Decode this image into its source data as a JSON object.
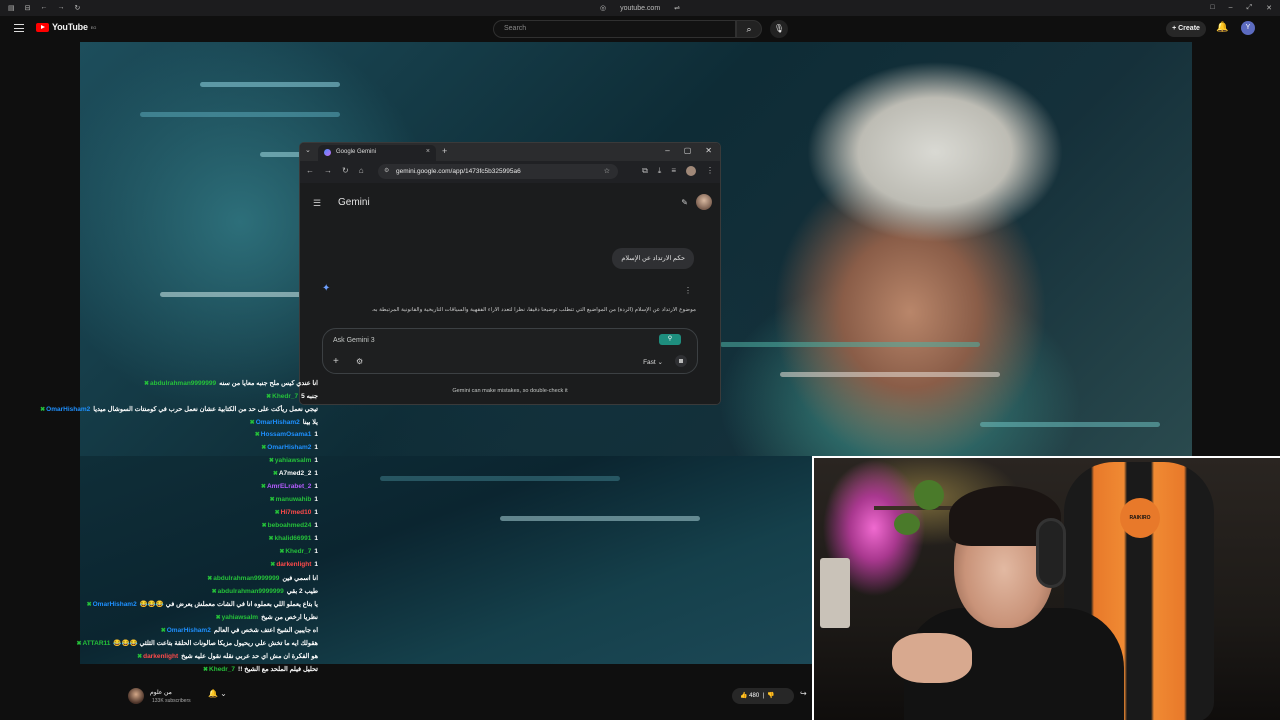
{
  "browser": {
    "url": "youtube.com"
  },
  "youtube": {
    "logo": "YouTube",
    "logo_region": "EG",
    "search_placeholder": "Search",
    "create_label": "Create",
    "avatar_letter": "Y"
  },
  "gemini_window": {
    "tab_title": "Google Gemini",
    "url": "gemini.google.com/app/1473fc5b325995a6",
    "brand": "Gemini",
    "user_prompt": "حكم الارتداد عن الإسلام",
    "response_preview": "موضوع الارتداد عن الإسلام (الردة) من المواضيع التي تتطلب توضيحاً دقيقاً، نظراً لتعدد الآراء الفقهية والسياقات التاريخية والقانونية المرتبطة به.",
    "input_placeholder": "Ask Gemini 3",
    "mode_label": "Fast",
    "disclaimer": "Gemini can make mistakes, so double-check it"
  },
  "chat": {
    "lines": [
      {
        "user": "abdulrahman9999999",
        "msg": "انا عندي كيس ملح جنبه معايا من سنه",
        "color": "#25c03a"
      },
      {
        "user": "Khedr_7",
        "msg": "جنبه 5",
        "color": "#25c03a"
      },
      {
        "user": "OmarHisham2",
        "msg": "تيجي نعمل ريأكت على حد من الكتابية عشان نعمل حرب في كومنتات السوشال ميديا",
        "color": "#1e90ff"
      },
      {
        "user": "OmarHisham2",
        "msg": "يلا بينا",
        "color": "#1e90ff"
      },
      {
        "user": "HossamOsama1",
        "msg": "1",
        "color": "#1e90ff"
      },
      {
        "user": "OmarHisham2",
        "msg": "1",
        "color": "#1e90ff"
      },
      {
        "user": "yahiawsalm",
        "msg": "1",
        "color": "#25c03a"
      },
      {
        "user": "A7med2_2",
        "msg": "1",
        "color": "#ffffff"
      },
      {
        "user": "AmrELrabet_2",
        "msg": "1",
        "color": "#b55bff"
      },
      {
        "user": "manuwahib",
        "msg": "1",
        "color": "#25c03a"
      },
      {
        "user": "Hi7med10",
        "msg": "1",
        "color": "#ff4a4a"
      },
      {
        "user": "beboahmed24",
        "msg": "1",
        "color": "#25c03a"
      },
      {
        "user": "khalid66991",
        "msg": "1",
        "color": "#25c03a"
      },
      {
        "user": "Khedr_7",
        "msg": "1",
        "color": "#25c03a"
      },
      {
        "user": "darkenlight",
        "msg": "1",
        "color": "#ff4a4a"
      },
      {
        "user": "abdulrahman9999999",
        "msg": "انا اسمي فين",
        "color": "#25c03a"
      },
      {
        "user": "abdulrahman9999999",
        "msg": "طيب 2 بقي",
        "color": "#25c03a"
      },
      {
        "user": "OmarHisham2",
        "msg": "😂😂😂 يا بتاع يعملو اللي بعملوه انا في الشات معملش يعرض في",
        "color": "#1e90ff"
      },
      {
        "user": "yahiawsalm",
        "msg": "نظريا ارخص من شيخ",
        "color": "#25c03a"
      },
      {
        "user": "OmarHisham2",
        "msg": "اه جايبين الشيخ اعتف شخص في العالم",
        "color": "#1e90ff"
      },
      {
        "user": "ATTAR11",
        "msg": "😂😂😂 هقولك ايه ما تخش علي ريحيول مزيكا صالونات الحلقة بتاعت الثلثي",
        "color": "#25c03a"
      },
      {
        "user": "darkenlight",
        "msg": "هو الفكرة ان مش اي حد عربي نقله نقول عليه شيخ",
        "color": "#ff4a4a"
      },
      {
        "user": "Khedr_7",
        "msg": "!! تحليل فيلم الملحد مع الشيخ",
        "color": "#25c03a"
      }
    ]
  },
  "video_meta": {
    "channel_name": "من علوم",
    "subscribers": "133K subscribers",
    "likes": "480"
  },
  "webcam": {
    "chair_brand": "RAIKIRO"
  },
  "colors": {
    "youtube_red": "#ff0000",
    "gemini_blue": "#6ea0ff",
    "chair_orange": "#e8792a"
  }
}
